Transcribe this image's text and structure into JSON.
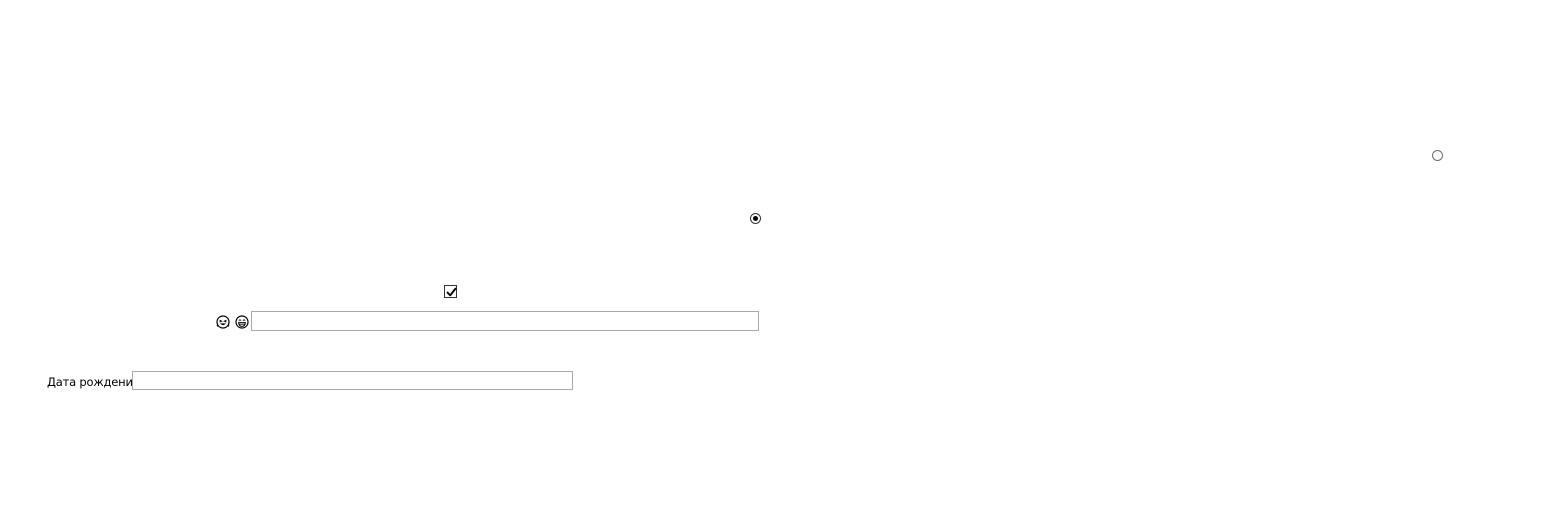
{
  "radio_top_right": {
    "checked": false
  },
  "radio_middle": {
    "checked": true
  },
  "checkbox": {
    "checked": true
  },
  "emoji_icons": [
    "rofl-face-icon",
    "grinning-face-icon"
  ],
  "emoji_input": {
    "value": "",
    "placeholder": ""
  },
  "birthdate": {
    "label": "Дата рождения",
    "value": "",
    "placeholder": ""
  }
}
